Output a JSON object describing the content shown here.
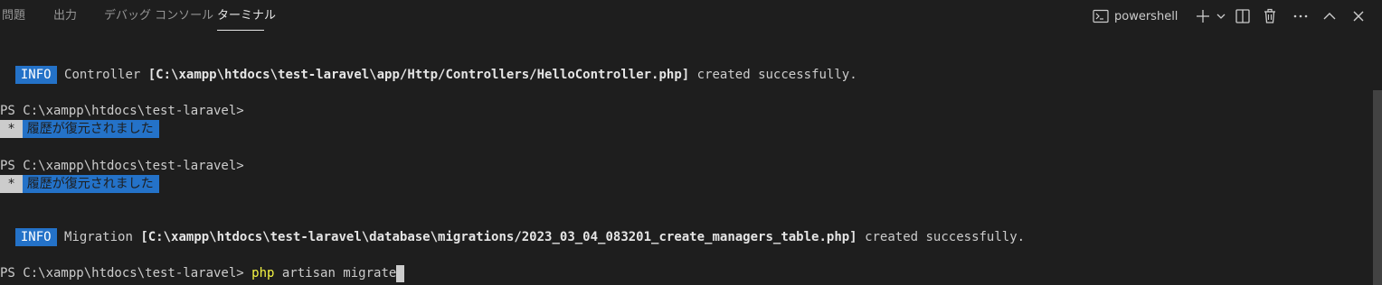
{
  "panel": {
    "tabs": [
      {
        "label": "問題",
        "active": false
      },
      {
        "label": "出力",
        "active": false
      },
      {
        "label": "デバッグ コンソール",
        "active": false
      },
      {
        "label": "ターミナル",
        "active": true
      }
    ],
    "shell_name": "powershell",
    "icons": [
      "terminal-icon",
      "plus-icon",
      "chevron-down-icon",
      "split-icon",
      "trash-icon",
      "more-icon",
      "chevron-up-icon",
      "close-icon"
    ]
  },
  "terminal": {
    "info_badge": "INFO",
    "line1": {
      "label": "Controller",
      "path": "[C:\\xampp\\htdocs\\test-laravel\\app/Http/Controllers/HelloController.php]",
      "suffix": "created successfully."
    },
    "prompt": "PS C:\\xampp\\htdocs\\test-laravel>",
    "restored_star": " * ",
    "restored_text": " 履歴が復元されました",
    "line2": {
      "label": "Migration",
      "path": "[C:\\xampp\\htdocs\\test-laravel\\database\\migrations/2023_03_04_083201_create_managers_table.php]",
      "suffix": "created successfully."
    },
    "command": {
      "program": "php",
      "args": " artisan migrate"
    }
  },
  "colors": {
    "background": "#1e1e1e",
    "info_badge": "#2472c8",
    "restored_highlight": "#2472c8",
    "command_yellow": "#f5f543"
  }
}
